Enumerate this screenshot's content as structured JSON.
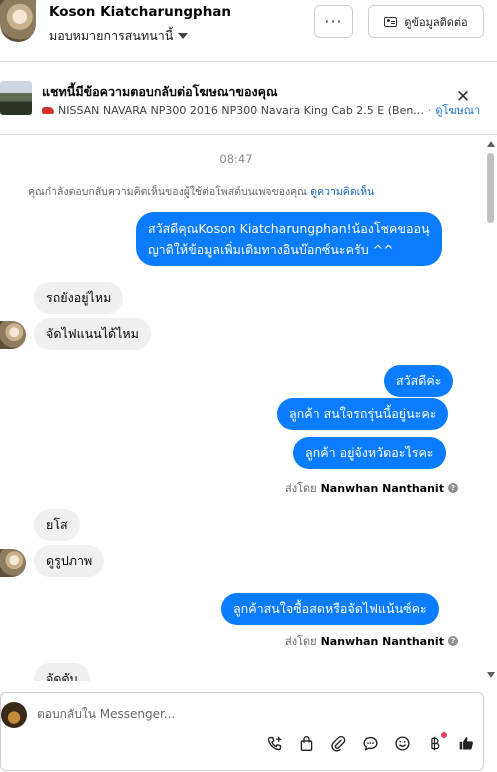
{
  "header": {
    "contact_name": "Koson Kiatcharungphan",
    "assign_label": "มอบหมายการสนทนานี้",
    "more_label": "···",
    "contact_info_label": "ดูข้อมูลติดต่อ"
  },
  "ad": {
    "title": "แชทนี้มีข้อความตอบกลับต่อโฆษณาของคุณ",
    "subtitle": "NISSAN NAVARA NP300 2016 NP300 Navara King Cab 2.5 E (Ben...",
    "separator": "·",
    "link": "ดูโฆษณา",
    "close": "✕"
  },
  "thread": {
    "time": "08:47",
    "notice_text": "คุณกำลังตอบกลับความคิดเห็นของผู้ใช้ต่อโพสต์บนเพจของคุณ",
    "notice_link": "ดูความคิดเห็น",
    "messages": [
      {
        "dir": "out",
        "line1": "สวัสดีคุณKoson Kiatcharungphan!น้องโชคขออนุ",
        "line2": "ญาติให้ข้อมูลเพิ่มเติมทางอินบ๊อกซ์นะครับ ^^"
      },
      {
        "dir": "in",
        "text": "รถยังอยู่ไหม"
      },
      {
        "dir": "in",
        "text": "จัดไฟแนนได้ไหม"
      },
      {
        "dir": "out",
        "text": "สวัสดีค่ะ"
      },
      {
        "dir": "out",
        "text": "ลูกค้า สนใจรถรุ่นนี้อยู่นะคะ"
      },
      {
        "dir": "out",
        "text": "ลูกค้า อยู่จังหวัดอะไรคะ"
      },
      {
        "dir": "in",
        "text": "ยโส"
      },
      {
        "dir": "in",
        "text": "ดูรูปภาพ"
      },
      {
        "dir": "out",
        "text": "ลูกค้าสนใจซื้อสดหรือจัดไฟแน้นซ์คะ"
      },
      {
        "dir": "in",
        "text": "จัดดับ"
      }
    ],
    "sent_by_label": "ส่งโดย",
    "sender_name": "Nanwhan Nanthanit",
    "info_glyph": "?"
  },
  "composer": {
    "placeholder": "ตอบกลับใน Messenger...",
    "tools": [
      "add-contact-icon",
      "shopping-bag-icon",
      "attachment-icon",
      "saved-reply-icon",
      "emoji-icon",
      "baht-icon",
      "like-icon"
    ]
  },
  "colors": {
    "outgoing_bubble": "#0a7cff",
    "incoming_bubble": "#f0f0f0",
    "link": "#1565c0"
  }
}
